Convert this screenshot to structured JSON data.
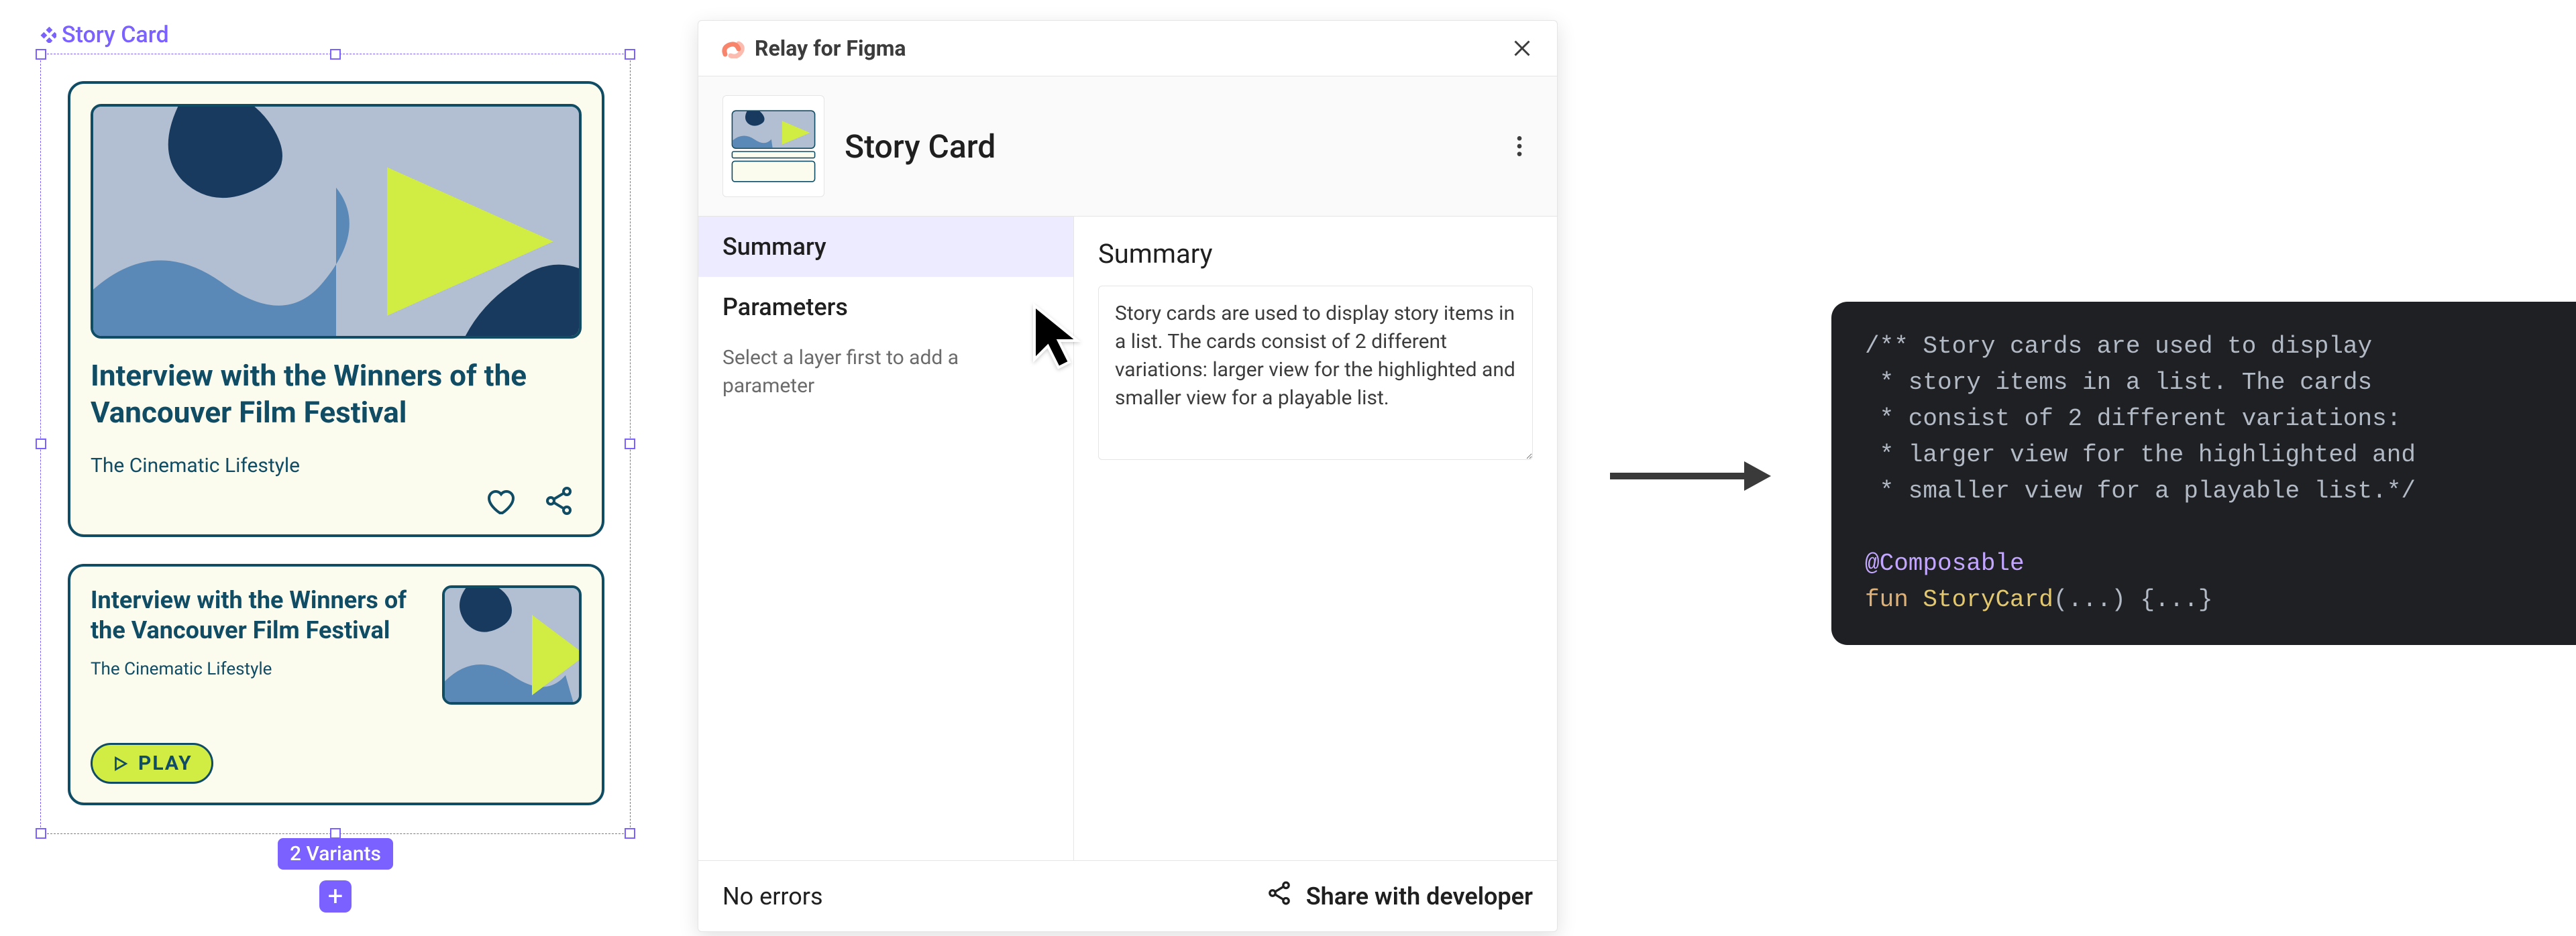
{
  "figma": {
    "frame_label": "Story Card",
    "variants_badge": "2 Variants"
  },
  "card_large": {
    "title": "Interview with the Winners of the Vancouver Film Festival",
    "subtitle": "The Cinematic Lifestyle"
  },
  "card_small": {
    "title": "Interview with the Winners of the Vancouver Film Festival",
    "subtitle": "The Cinematic Lifestyle",
    "play_label": "PLAY"
  },
  "panel": {
    "brand": "Relay for Figma",
    "component_title": "Story Card",
    "tabs": {
      "summary": "Summary",
      "parameters": "Parameters"
    },
    "parameters_hint": "Select a layer first to add a parameter",
    "content_heading": "Summary",
    "summary_text": "Story cards are used to display story items in a list. The cards consist of 2 different variations: larger view for the highlighted and smaller view for a playable list.",
    "footer_status": "No errors",
    "footer_share": "Share with developer"
  },
  "code": {
    "c1": "/** Story cards are used to display",
    "c2": " * story items in a list. The cards",
    "c3": " * consist of 2 different variations:",
    "c4": " * larger view for the highlighted and",
    "c5": " * smaller view for a playable list.*/",
    "annotation": "@Composable",
    "kw_fun": "fun",
    "fn_name": "StoryCard",
    "args": "(...) ",
    "body": "{...}"
  }
}
